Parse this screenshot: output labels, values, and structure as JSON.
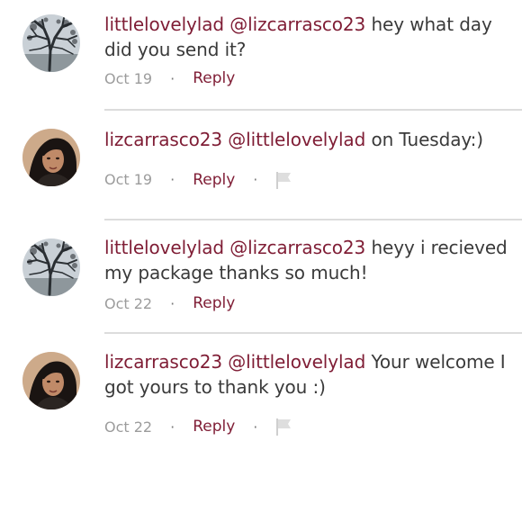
{
  "comments": [
    {
      "user": "littlelovelylad",
      "mention": "@lizcarrasco23",
      "text": " hey what day did you send it?",
      "date": "Oct 19",
      "dot": "·",
      "reply": "Reply",
      "avatar_icon": "tree-silhouette-avatar",
      "flag": false
    },
    {
      "user": "lizcarrasco23",
      "mention": "@littlelovelylad",
      "text": " on Tuesday:)",
      "date": "Oct 19",
      "dot": "·",
      "reply": "Reply",
      "avatar_icon": "woman-portrait-avatar",
      "flag": true
    },
    {
      "user": "littlelovelylad",
      "mention": "@lizcarrasco23",
      "text": " heyy i recieved my package thanks so much!",
      "date": "Oct 22",
      "dot": "·",
      "reply": "Reply",
      "avatar_icon": "tree-silhouette-avatar",
      "flag": false
    },
    {
      "user": "lizcarrasco23",
      "mention": "@littlelovelylad",
      "text": " Your welcome I got yours to thank you :)",
      "date": "Oct 22",
      "dot": "·",
      "reply": "Reply",
      "avatar_icon": "woman-portrait-avatar",
      "flag": true
    }
  ],
  "colors": {
    "accent": "#7f1d35",
    "body_text": "#3a3a3a",
    "meta_text": "#9c9c9c",
    "divider": "#dcdcdc"
  }
}
